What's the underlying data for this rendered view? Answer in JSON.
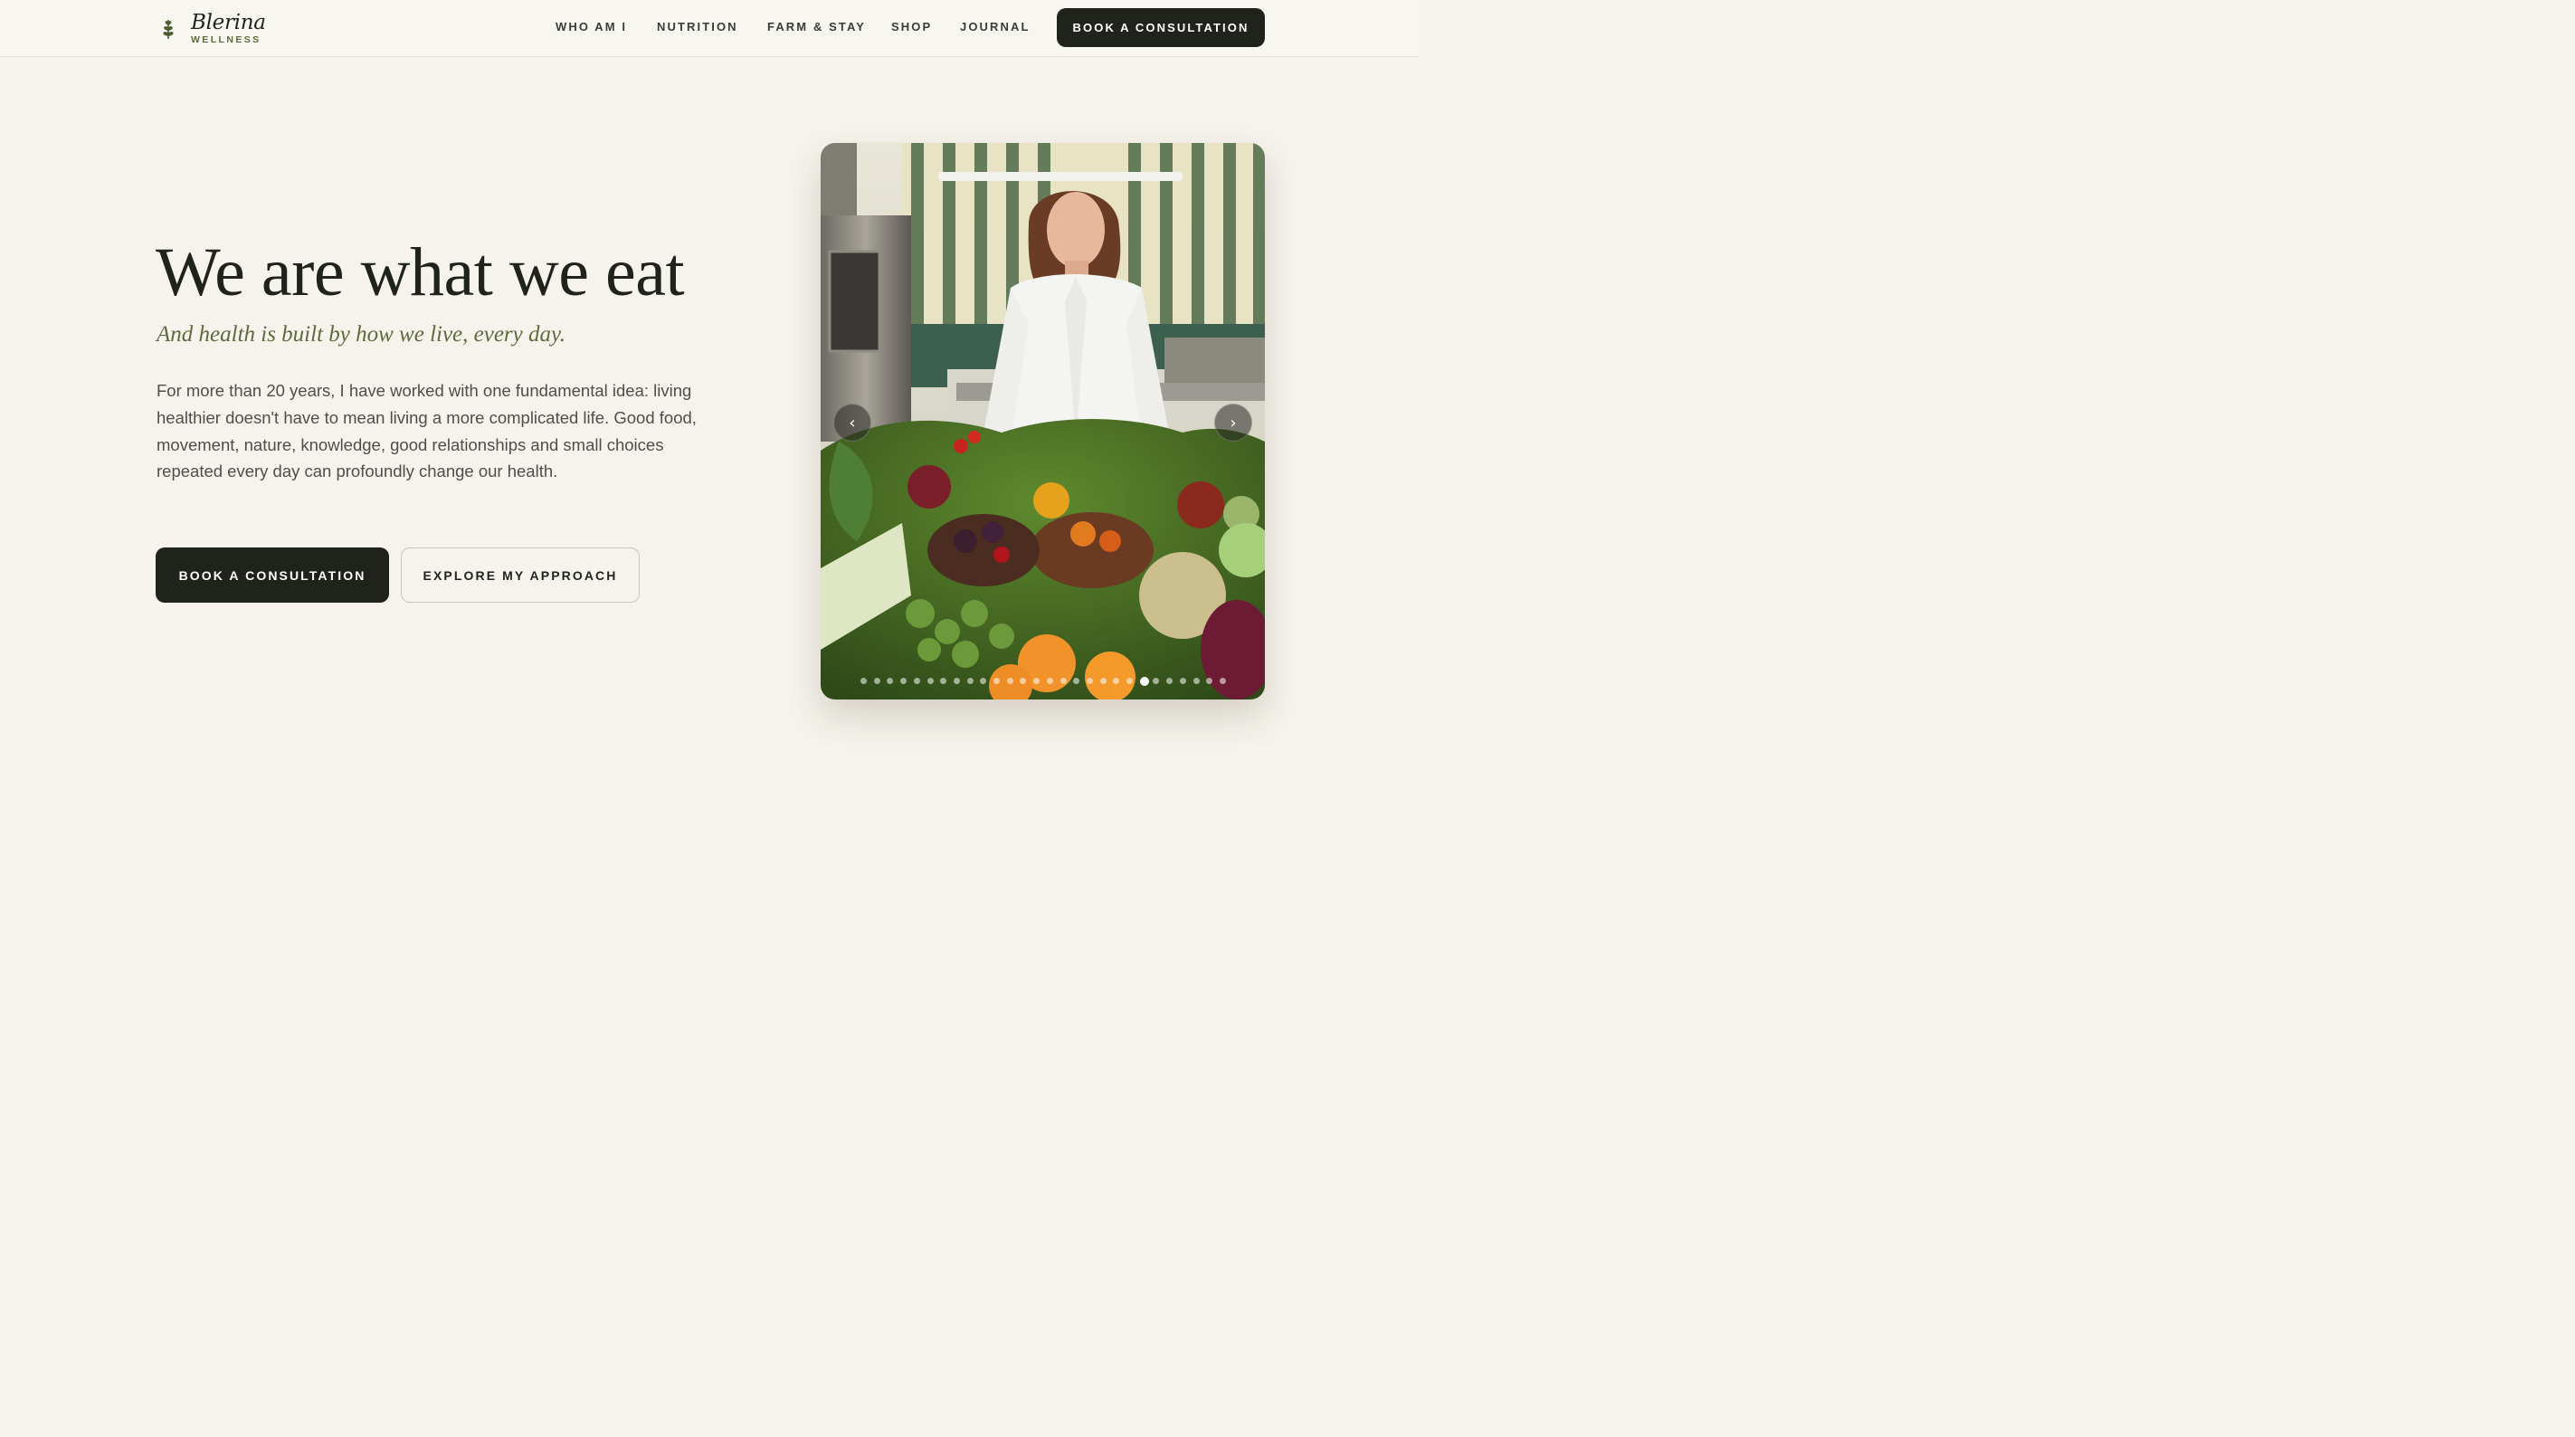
{
  "brand": {
    "name": "Blerina",
    "tagline": "WELLNESS",
    "accent": "#5b6b3a",
    "dark": "#1f231b",
    "background": "#f6f3ec"
  },
  "nav": {
    "items": [
      {
        "label": "WHO AM I"
      },
      {
        "label": "NUTRITION"
      },
      {
        "label": "FARM & STAY"
      },
      {
        "label": "SHOP"
      },
      {
        "label": "JOURNAL"
      }
    ],
    "cta_label": "BOOK A CONSULTATION"
  },
  "hero": {
    "title": "We are what we eat",
    "subtitle": "And health is built by how we live, every day.",
    "body": "For more than 20 years, I have worked with one fundamental idea: living healthier doesn't have to mean living a more complicated life. Good food, movement, nature, knowledge, good relationships and small choices repeated every day can profoundly change our health.",
    "primary_label": "BOOK A CONSULTATION",
    "secondary_label": "EXPLORE MY APPROACH"
  },
  "carousel": {
    "slide_count": 28,
    "active_slide": 21,
    "prev_icon": "chevron-left-icon",
    "next_icon": "chevron-right-icon",
    "prev_glyph": "‹",
    "next_glyph": "›"
  }
}
